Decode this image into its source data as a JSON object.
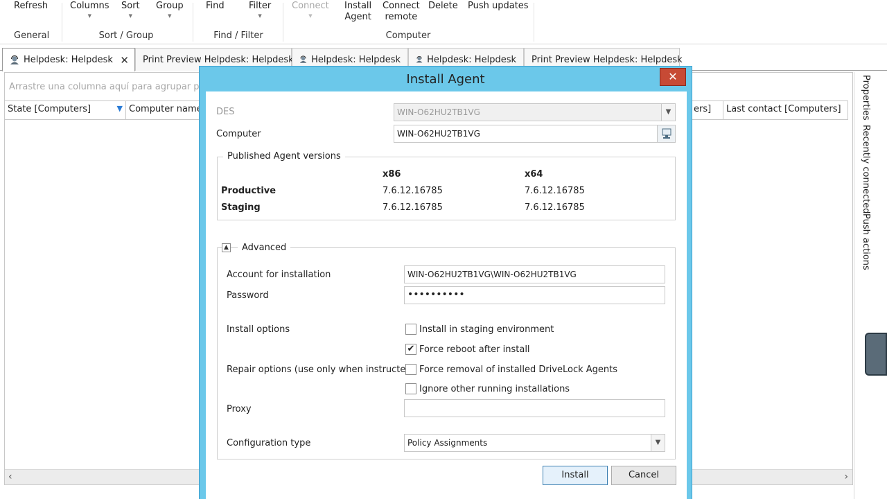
{
  "ribbon": {
    "refresh": "Refresh",
    "columns": "Columns",
    "sort": "Sort",
    "group": "Group",
    "find": "Find",
    "filter": "Filter",
    "connect": "Connect",
    "install_agent_1": "Install",
    "install_agent_2": "Agent",
    "connect_remote_1": "Connect",
    "connect_remote_2": "remote",
    "delete": "Delete",
    "push_updates": "Push updates",
    "group_general": "General",
    "group_sort": "Sort / Group",
    "group_find": "Find / Filter",
    "group_computer": "Computer"
  },
  "tabs": [
    {
      "label": "Helpdesk: Helpdesk",
      "icon": "helpdesk-icon",
      "active": true
    },
    {
      "label": "Print Preview Helpdesk: Helpdesk",
      "icon": "",
      "active": false
    },
    {
      "label": "Helpdesk: Helpdesk",
      "icon": "helpdesk-icon",
      "active": false
    },
    {
      "label": "Helpdesk: Helpdesk",
      "icon": "helpdesk-icon",
      "active": false
    },
    {
      "label": "Print Preview Helpdesk: Helpdesk",
      "icon": "",
      "active": false
    }
  ],
  "tab_close_glyph": "✕",
  "grid": {
    "group_hint": "Arrastre una columna aquí para agrupar por d",
    "columns": [
      "State [Computers]",
      "Computer name",
      "ers]",
      "Last contact [Computers]"
    ]
  },
  "side_tabs": [
    "Properties",
    "Recently connected",
    "Push actions"
  ],
  "dialog": {
    "title": "Install Agent",
    "des_label": "DES",
    "des_value": "WIN-O62HU2TB1VG",
    "computer_label": "Computer",
    "computer_value": "WIN-O62HU2TB1VG",
    "published_title": "Published Agent versions",
    "x86": "x86",
    "x64": "x64",
    "productive_label": "Productive",
    "productive_x86": "7.6.12.16785",
    "productive_x64": "7.6.12.16785",
    "staging_label": "Staging",
    "staging_x86": "7.6.12.16785",
    "staging_x64": "7.6.12.16785",
    "advanced_title": "Advanced",
    "account_label": "Account for installation",
    "account_value": "WIN-O62HU2TB1VG\\WIN-O62HU2TB1VG",
    "password_label": "Password",
    "password_value": "••••••••••",
    "install_options_label": "Install options",
    "opt_staging": "Install in staging environment",
    "opt_reboot": "Force reboot after install",
    "repair_label": "Repair options (use only when instructed)",
    "opt_force_removal": "Force removal of installed DriveLock Agents",
    "opt_ignore_running": "Ignore other running installations",
    "proxy_label": "Proxy",
    "proxy_value": "",
    "config_label": "Configuration type",
    "config_value": "Policy Assignments",
    "install_button": "Install",
    "cancel_button": "Cancel",
    "checks": {
      "staging": false,
      "reboot": true,
      "force_removal": false,
      "ignore_running": false
    }
  },
  "colors": {
    "dialog_frame": "#6bc8ea",
    "close_red": "#c74a35",
    "filter_blue": "#2a7bd6"
  }
}
